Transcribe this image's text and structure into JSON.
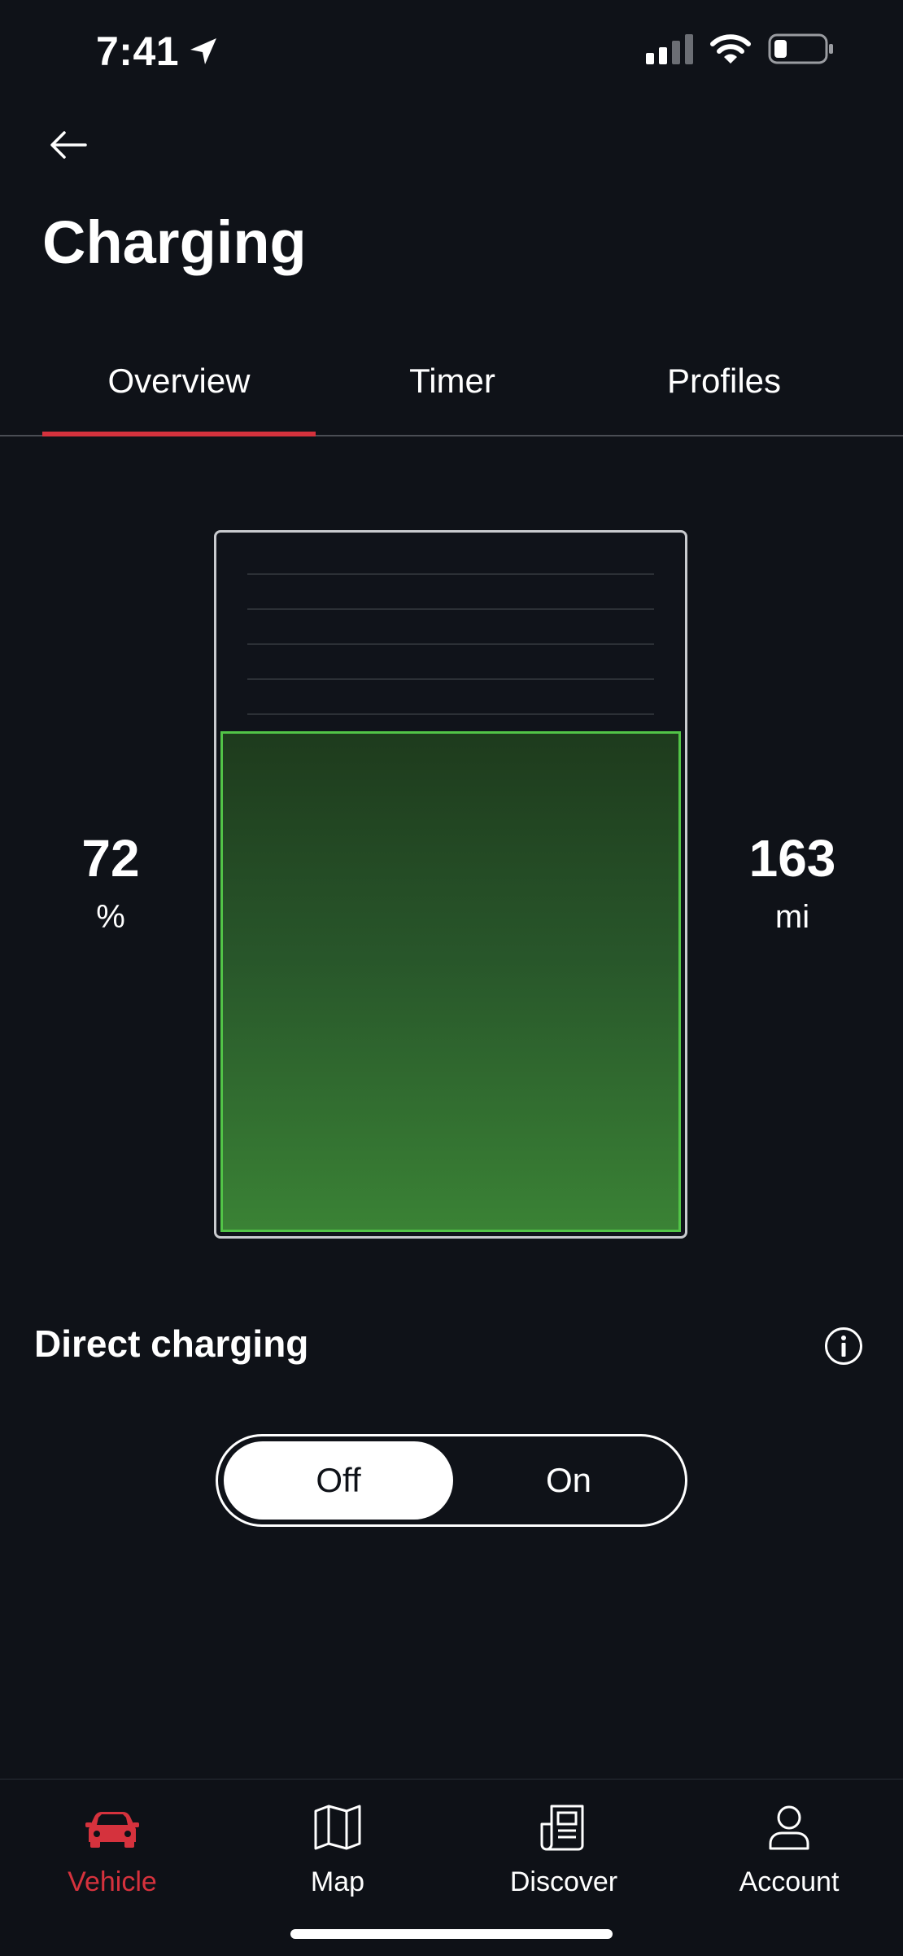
{
  "status_bar": {
    "time": "7:41"
  },
  "header": {
    "title": "Charging"
  },
  "tabs": [
    {
      "label": "Overview",
      "active": true
    },
    {
      "label": "Timer",
      "active": false
    },
    {
      "label": "Profiles",
      "active": false
    }
  ],
  "battery": {
    "percent_value": "72",
    "percent_unit": "%",
    "range_value": "163",
    "range_unit": "mi",
    "fill_fraction": 0.72
  },
  "direct_charging": {
    "label": "Direct charging",
    "options": [
      "Off",
      "On"
    ],
    "selected": "Off"
  },
  "bottom_nav": [
    {
      "label": "Vehicle",
      "icon": "car-icon",
      "active": true
    },
    {
      "label": "Map",
      "icon": "map-icon",
      "active": false
    },
    {
      "label": "Discover",
      "icon": "news-icon",
      "active": false
    },
    {
      "label": "Account",
      "icon": "account-icon",
      "active": false
    }
  ],
  "colors": {
    "background": "#0f1218",
    "accent_red": "#d5323d",
    "battery_green": "#52c447"
  }
}
